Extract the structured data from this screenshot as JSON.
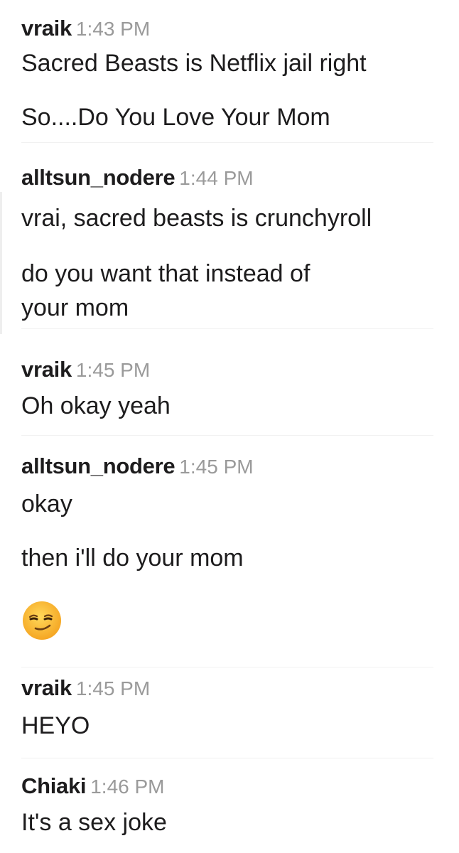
{
  "messages": [
    {
      "author": "vraik",
      "time": "1:43 PM",
      "lines": [
        "Sacred Beasts is Netflix jail right",
        "So....Do You Love Your Mom"
      ]
    },
    {
      "author": "alltsun_nodere",
      "time": "1:44 PM",
      "lines": [
        "vrai, sacred beasts is crunchyroll",
        "do you want that instead of",
        "your mom"
      ]
    },
    {
      "author": "vraik",
      "time": "1:45 PM",
      "lines": [
        "Oh okay yeah"
      ]
    },
    {
      "author": "alltsun_nodere",
      "time": "1:45 PM",
      "lines": [
        "okay",
        "then i'll do your mom"
      ],
      "emoji": "smirking-face-emoji"
    },
    {
      "author": "vraik",
      "time": "1:45 PM",
      "lines": [
        "HEYO"
      ]
    },
    {
      "author": "Chiaki",
      "time": "1:46 PM",
      "lines": [
        "It's a sex joke"
      ]
    }
  ],
  "colors": {
    "author": "#1d1c1d",
    "timestamp": "#9a9a9a",
    "text": "#1d1c1d",
    "emoji_face": "#f7b52b"
  }
}
